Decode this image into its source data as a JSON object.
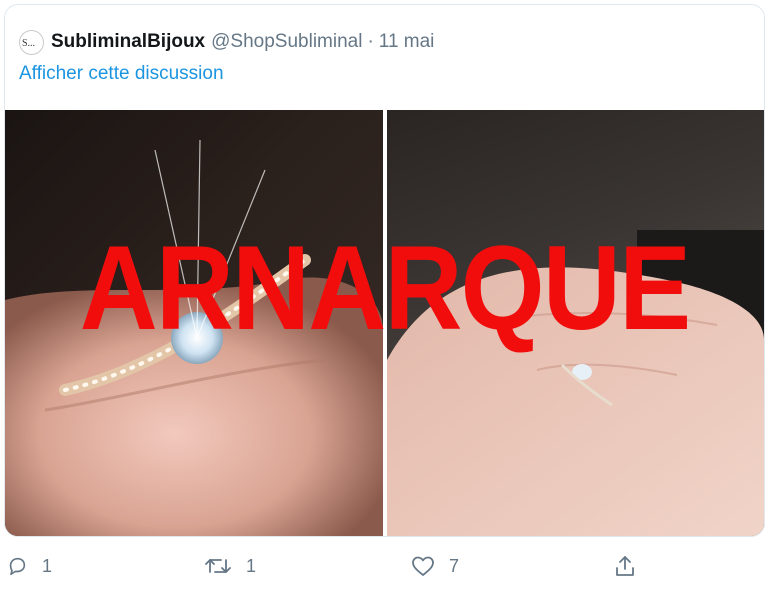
{
  "tweet": {
    "display_name": "SubliminalBijoux",
    "handle": "@ShopSubliminal",
    "separator": "·",
    "date": "11 mai",
    "avatar_text": "S...",
    "show_thread": "Afficher cette discussion"
  },
  "media": {
    "overlay_text": "ARNARQUE",
    "overlay_color": "#f20d0d",
    "photos": [
      {
        "icon": "ring-on-finger-closeup"
      },
      {
        "icon": "ring-on-hand"
      }
    ]
  },
  "actions": {
    "reply_count": "1",
    "retweet_count": "1",
    "like_count": "7"
  },
  "colors": {
    "link": "#1b95e0",
    "secondary_text": "#657786",
    "border": "#e1e8ed"
  }
}
